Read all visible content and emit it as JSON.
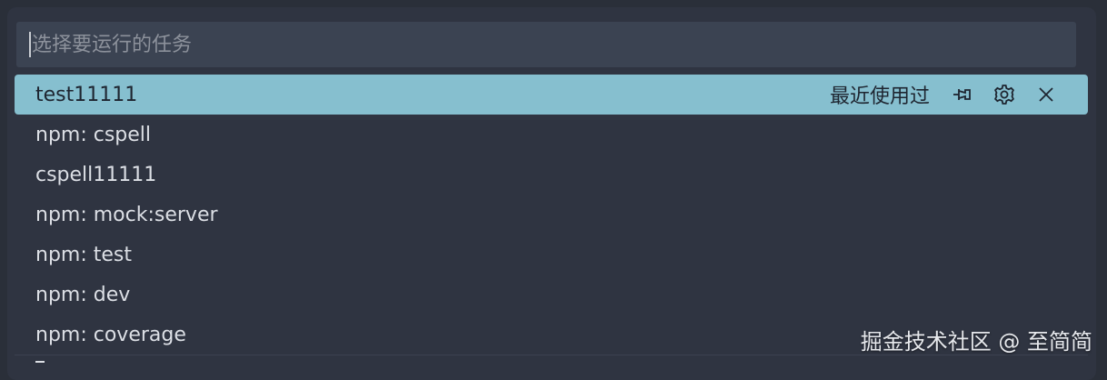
{
  "quick_pick": {
    "placeholder": "选择要运行的任务",
    "input_value": "",
    "selected_index": 0,
    "selected_detail": "最近使用过",
    "items": [
      {
        "label": "test11111"
      },
      {
        "label": "npm: cspell"
      },
      {
        "label": "cspell11111"
      },
      {
        "label": "npm: mock:server"
      },
      {
        "label": "npm: test"
      },
      {
        "label": "npm: dev"
      },
      {
        "label": "npm: coverage"
      }
    ],
    "actions": [
      {
        "name": "pin-icon",
        "title": "pin"
      },
      {
        "name": "gear-icon",
        "title": "configure"
      },
      {
        "name": "close-icon",
        "title": "remove"
      }
    ]
  },
  "watermark": {
    "text": "掘金技术社区 @ 至简简"
  },
  "colors": {
    "background": "#2a2f39",
    "panel": "#2f3441",
    "input": "#3b4352",
    "selected_row": "#86bfcf",
    "text": "#dcdfe5"
  }
}
